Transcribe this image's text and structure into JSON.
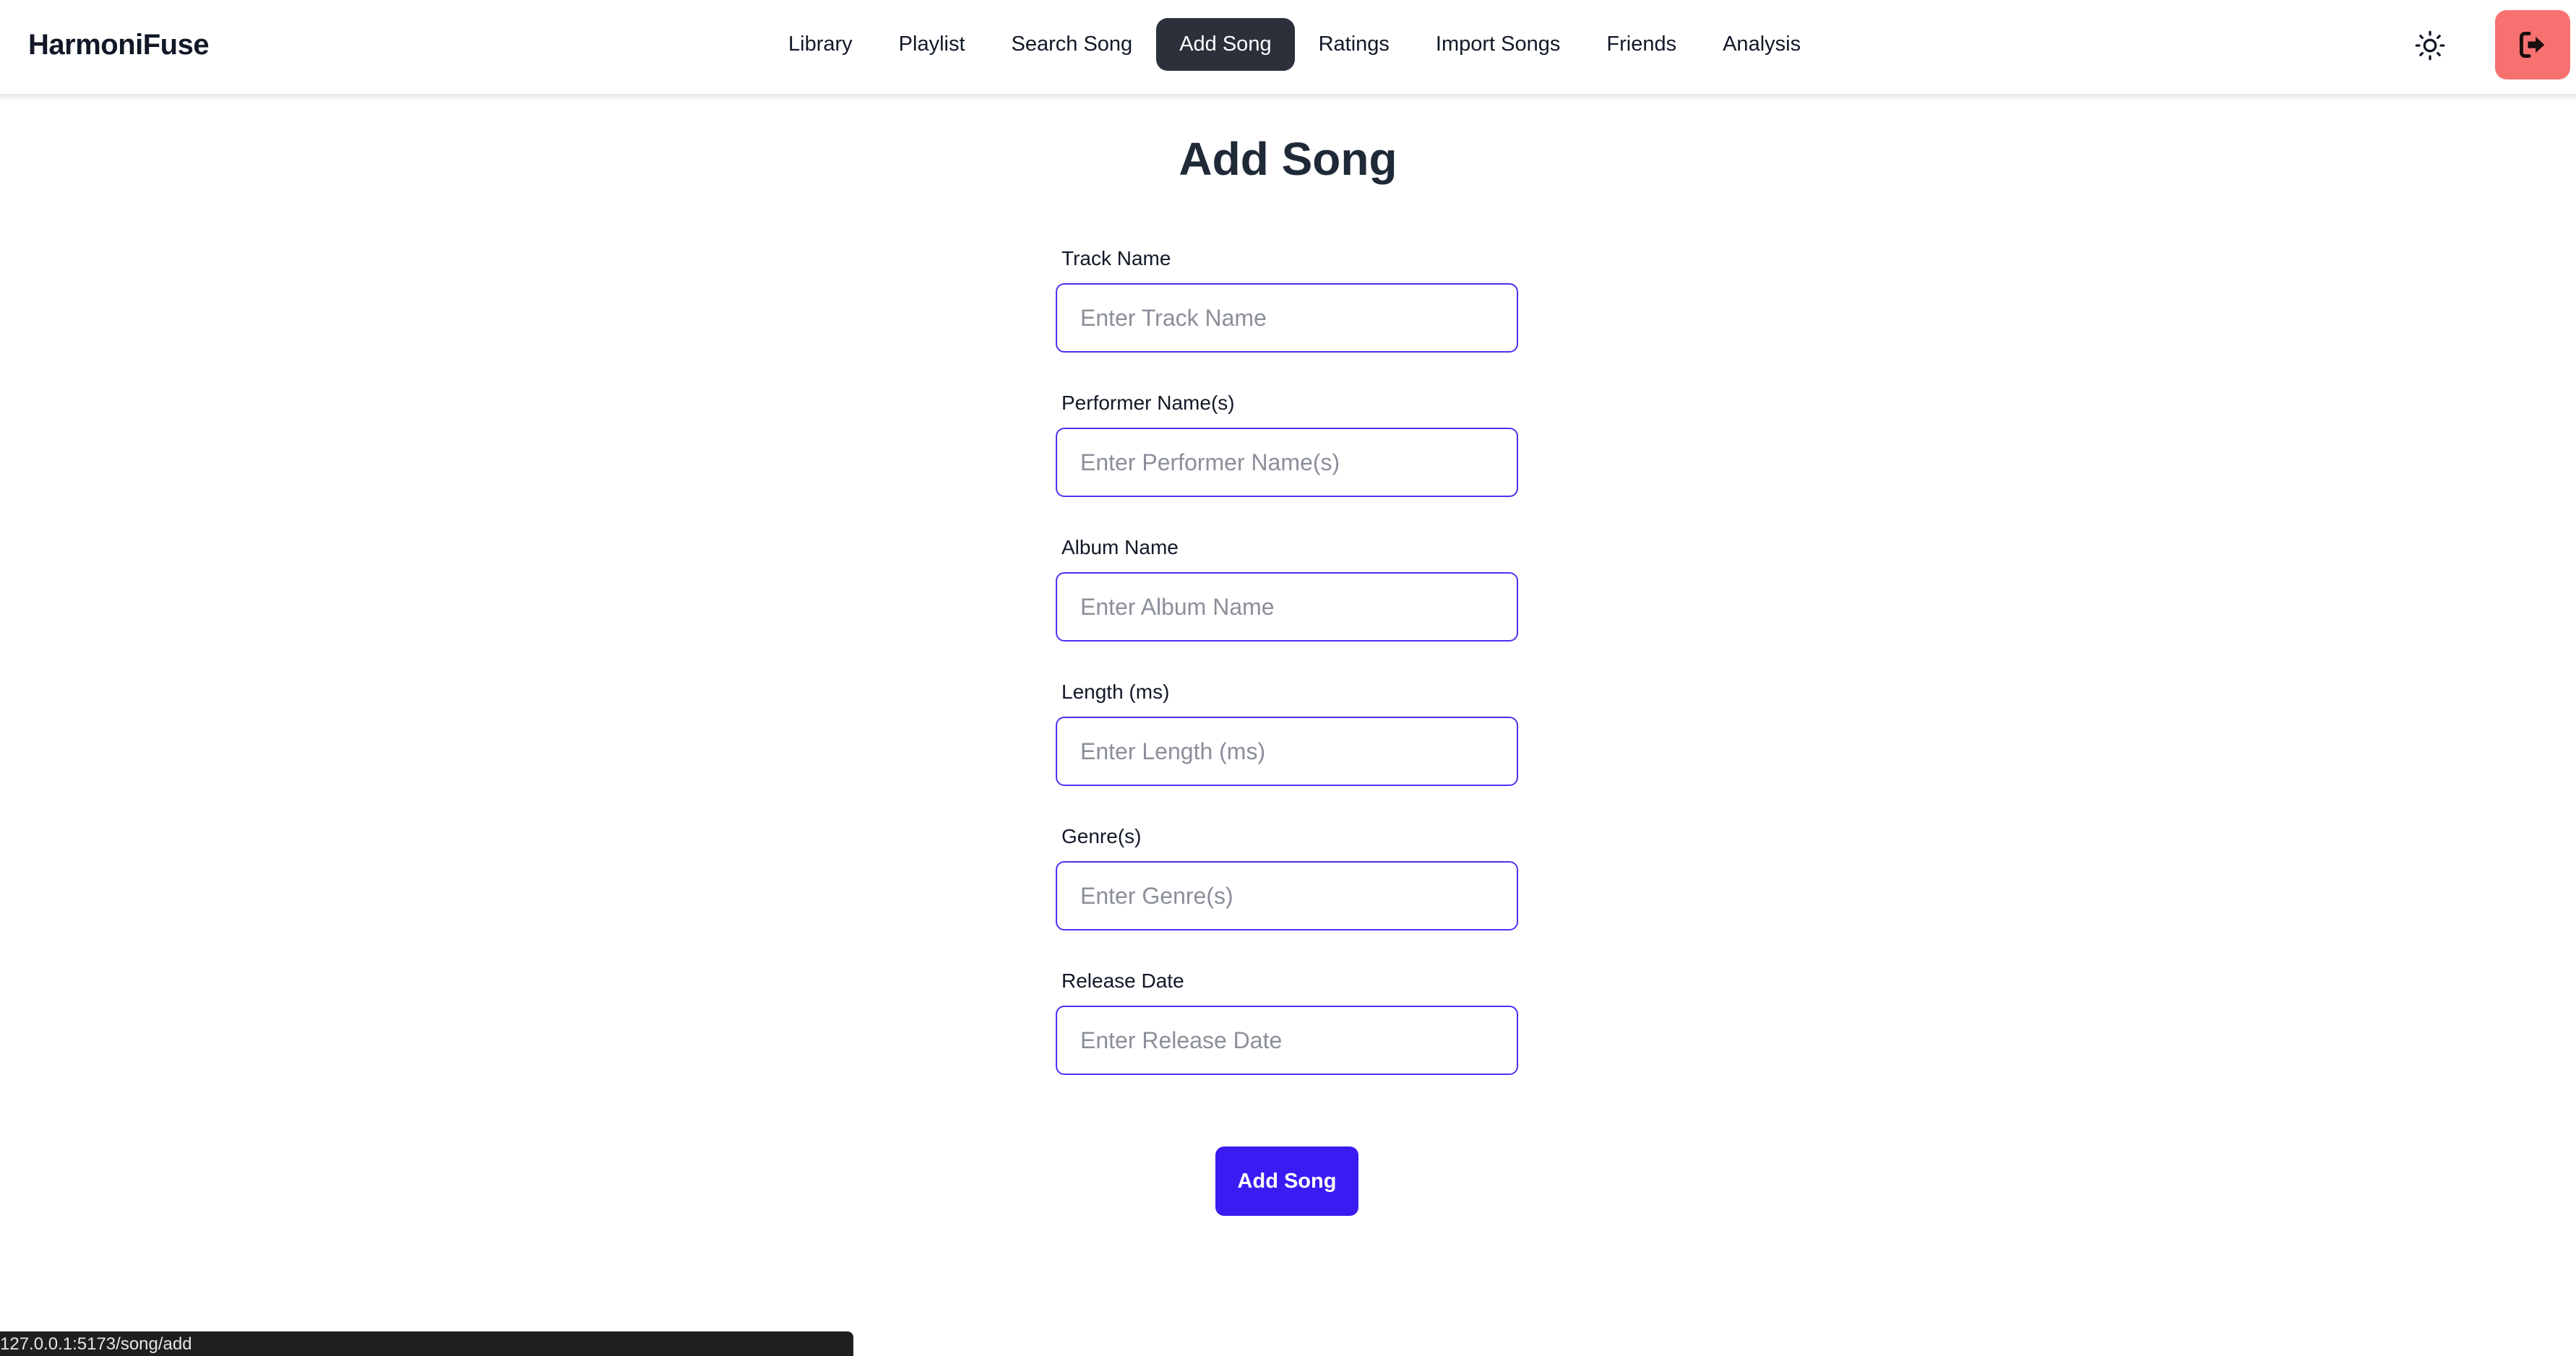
{
  "app": {
    "brand": "HarmoniFuse"
  },
  "nav": {
    "items": [
      {
        "label": "Library"
      },
      {
        "label": "Playlist"
      },
      {
        "label": "Search Song"
      },
      {
        "label": "Add Song",
        "active": true
      },
      {
        "label": "Ratings"
      },
      {
        "label": "Import Songs"
      },
      {
        "label": "Friends"
      },
      {
        "label": "Analysis"
      }
    ],
    "theme_toggle_icon": "sun-icon",
    "logout_icon": "logout-icon"
  },
  "page": {
    "title": "Add Song"
  },
  "form": {
    "fields": [
      {
        "label": "Track Name",
        "placeholder": "Enter Track Name",
        "value": ""
      },
      {
        "label": "Performer Name(s)",
        "placeholder": "Enter Performer Name(s)",
        "value": ""
      },
      {
        "label": "Album Name",
        "placeholder": "Enter Album Name",
        "value": ""
      },
      {
        "label": "Length (ms)",
        "placeholder": "Enter Length (ms)",
        "value": ""
      },
      {
        "label": "Genre(s)",
        "placeholder": "Enter Genre(s)",
        "value": ""
      },
      {
        "label": "Release Date",
        "placeholder": "Enter Release Date",
        "value": ""
      }
    ],
    "submit_label": "Add Song"
  },
  "status_bar": {
    "url": "127.0.0.1:5173/song/add"
  },
  "colors": {
    "accent": "#3a1cf2",
    "input_border": "#4f2ff0",
    "active_nav": "#2b303b",
    "logout": "#f87171"
  }
}
